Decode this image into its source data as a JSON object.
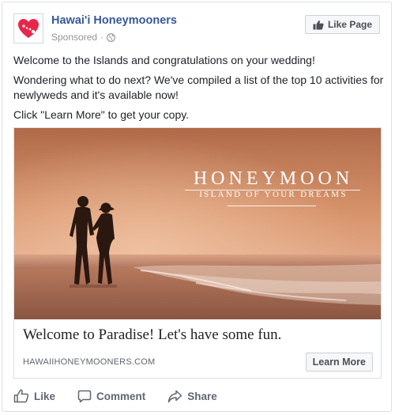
{
  "post": {
    "page_name": "Hawai'i Honeymooners",
    "sponsored_label": "Sponsored",
    "privacy_separator": "·",
    "like_page_label": "Like Page",
    "body": [
      "Welcome to the Islands and congratulations on your wedding!",
      "Wondering what to do next? We've compiled a list of the top 10 activities for newlyweds and it's available now!",
      "Click \"Learn More\" to get your copy."
    ]
  },
  "hero": {
    "title": "HONEYMOON",
    "subtitle": "ISLAND OF YOUR DREAMS"
  },
  "link": {
    "headline": "Welcome to Paradise! Let's have some fun.",
    "domain": "HAWAIIHONEYMOONERS.COM",
    "cta_label": "Learn More"
  },
  "actions": {
    "like_label": "Like",
    "comment_label": "Comment",
    "share_label": "Share"
  },
  "colors": {
    "brand_link": "#365899",
    "logo_heart": "#e8264a",
    "muted_text": "#90949c"
  },
  "icons": [
    "heart-logo-icon",
    "globe-icon",
    "thumbs-up-icon",
    "comment-icon",
    "share-icon"
  ]
}
